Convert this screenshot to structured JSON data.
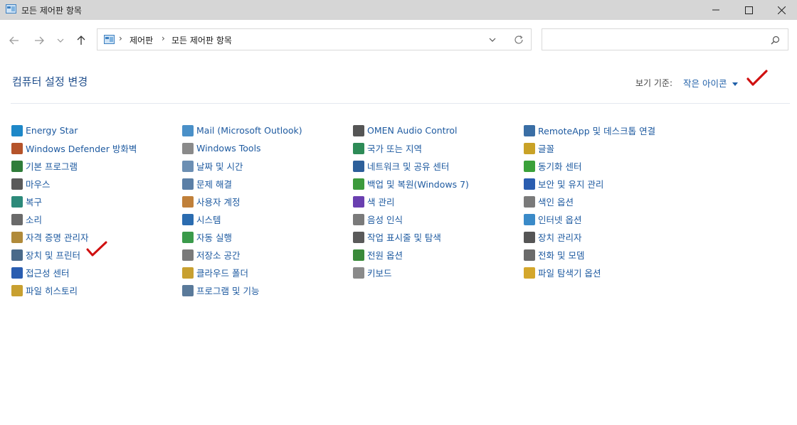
{
  "window": {
    "title": "모든 제어판 항목"
  },
  "address_bar": {
    "breadcrumbs": [
      "제어판",
      "모든 제어판 항목"
    ]
  },
  "search": {
    "placeholder": ""
  },
  "header": {
    "heading": "컴퓨터 설정 변경",
    "view_by_label": "보기 기준:",
    "view_by_value": "작은 아이콘"
  },
  "items": [
    {
      "label": "Energy Star",
      "icon": "energy-star-icon",
      "color": "#1e88c8"
    },
    {
      "label": "Mail (Microsoft Outlook)",
      "icon": "mail-icon",
      "color": "#4a90c8"
    },
    {
      "label": "OMEN Audio Control",
      "icon": "audio-control-icon",
      "color": "#555555"
    },
    {
      "label": "RemoteApp 및 데스크톱 연결",
      "icon": "remoteapp-icon",
      "color": "#3a6ea5"
    },
    {
      "label": "Windows Defender 방화벽",
      "icon": "firewall-icon",
      "color": "#b5532a"
    },
    {
      "label": "Windows Tools",
      "icon": "windows-tools-icon",
      "color": "#8a8a8a"
    },
    {
      "label": "국가 또는 지역",
      "icon": "globe-icon",
      "color": "#2e8b57"
    },
    {
      "label": "글꼴",
      "icon": "font-icon",
      "color": "#c9a227"
    },
    {
      "label": "기본 프로그램",
      "icon": "default-programs-icon",
      "color": "#2f7d3a"
    },
    {
      "label": "날짜 및 시간",
      "icon": "clock-icon",
      "color": "#6c8fb3"
    },
    {
      "label": "네트워크 및 공유 센터",
      "icon": "network-icon",
      "color": "#2d5f9a"
    },
    {
      "label": "동기화 센터",
      "icon": "sync-icon",
      "color": "#3aa13a"
    },
    {
      "label": "마우스",
      "icon": "mouse-icon",
      "color": "#5a5a5a"
    },
    {
      "label": "문제 해결",
      "icon": "troubleshoot-icon",
      "color": "#5b7fa6"
    },
    {
      "label": "백업 및 복원(Windows 7)",
      "icon": "backup-icon",
      "color": "#3c9a3c"
    },
    {
      "label": "보안 및 유지 관리",
      "icon": "flag-icon",
      "color": "#2a5db0"
    },
    {
      "label": "복구",
      "icon": "recovery-icon",
      "color": "#2d8a7a"
    },
    {
      "label": "사용자 계정",
      "icon": "user-accounts-icon",
      "color": "#c0803a"
    },
    {
      "label": "색 관리",
      "icon": "color-management-icon",
      "color": "#6a3fb0"
    },
    {
      "label": "색인 옵션",
      "icon": "indexing-icon",
      "color": "#7a7a7a"
    },
    {
      "label": "소리",
      "icon": "speaker-icon",
      "color": "#6a6a6a"
    },
    {
      "label": "시스템",
      "icon": "system-icon",
      "color": "#2b6cb0"
    },
    {
      "label": "음성 인식",
      "icon": "microphone-icon",
      "color": "#7a7a7a"
    },
    {
      "label": "인터넷 옵션",
      "icon": "internet-options-icon",
      "color": "#3a8ac8"
    },
    {
      "label": "자격 증명 관리자",
      "icon": "credential-icon",
      "color": "#b08a3a"
    },
    {
      "label": "자동 실행",
      "icon": "autoplay-icon",
      "color": "#3a9a4a"
    },
    {
      "label": "작업 표시줄 및 탐색",
      "icon": "taskbar-icon",
      "color": "#5a5a5a"
    },
    {
      "label": "장치 관리자",
      "icon": "device-manager-icon",
      "color": "#555555"
    },
    {
      "label": "장치 및 프린터",
      "icon": "printer-icon",
      "color": "#4a6a8a"
    },
    {
      "label": "저장소 공간",
      "icon": "storage-icon",
      "color": "#7a7a7a"
    },
    {
      "label": "전원 옵션",
      "icon": "power-icon",
      "color": "#3a8a3a"
    },
    {
      "label": "전화 및 모뎀",
      "icon": "phone-icon",
      "color": "#6a6a6a"
    },
    {
      "label": "접근성 센터",
      "icon": "accessibility-icon",
      "color": "#2a5db0"
    },
    {
      "label": "클라우드 폴더",
      "icon": "cloud-folder-icon",
      "color": "#c8a030"
    },
    {
      "label": "키보드",
      "icon": "keyboard-icon",
      "color": "#8a8a8a"
    },
    {
      "label": "파일 탐색기 옵션",
      "icon": "folder-options-icon",
      "color": "#d4a72c"
    },
    {
      "label": "파일 히스토리",
      "icon": "file-history-icon",
      "color": "#c8a030"
    },
    {
      "label": "프로그램 및 기능",
      "icon": "programs-icon",
      "color": "#5a7a9a"
    }
  ],
  "annotations": {
    "check_color": "#d01010"
  }
}
